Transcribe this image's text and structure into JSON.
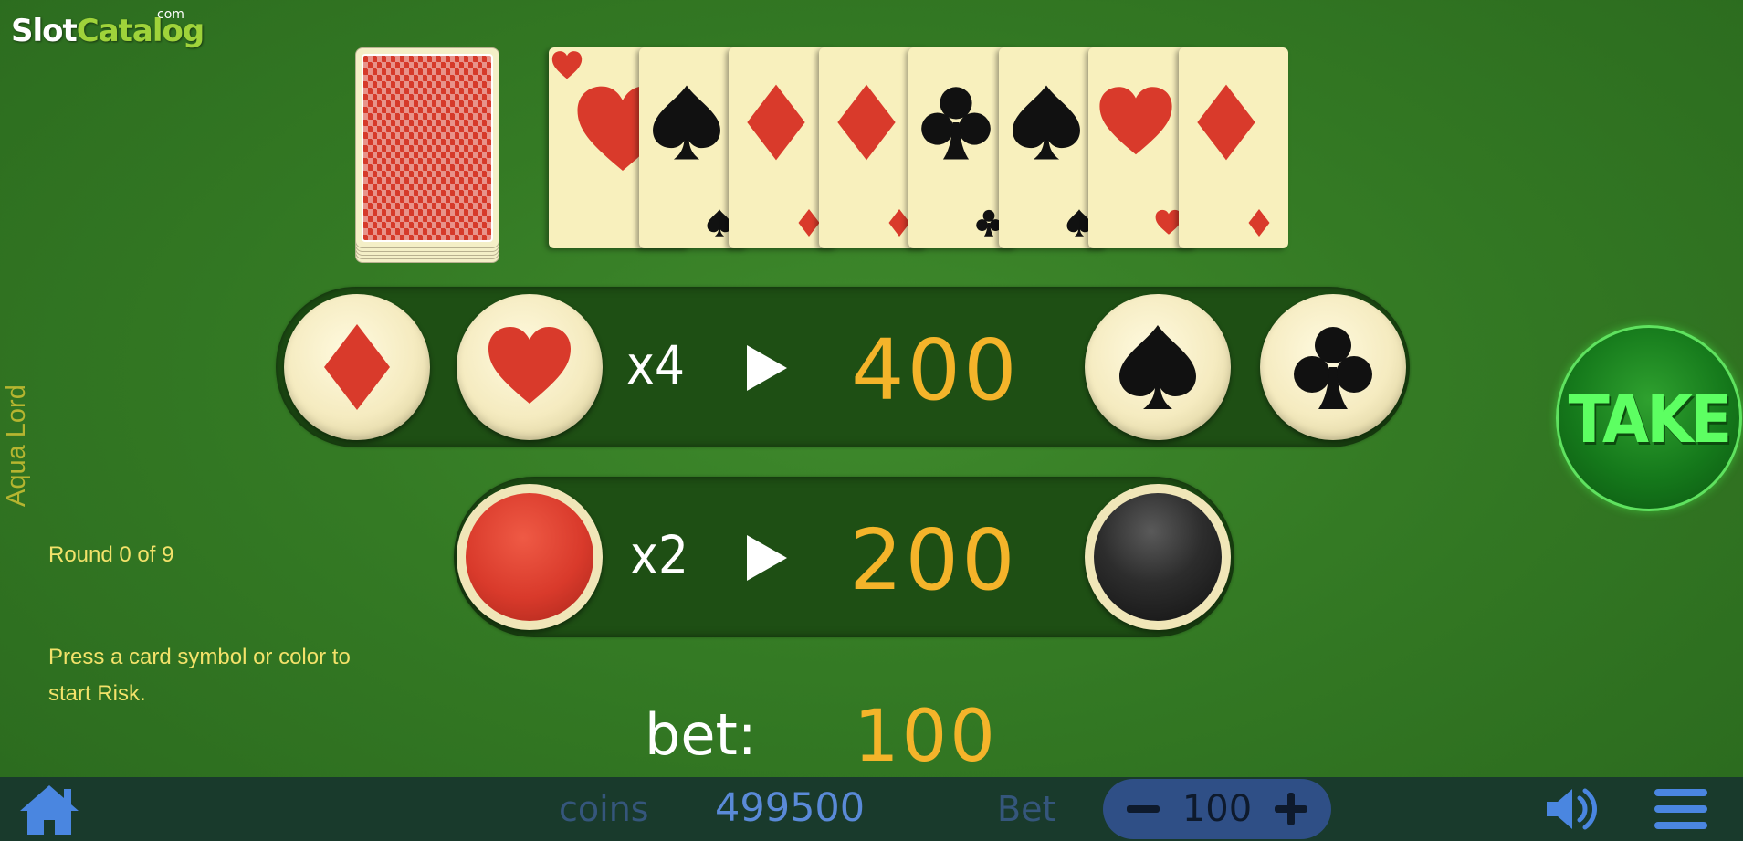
{
  "watermark": {
    "part1": "Slot",
    "part2": "Catalog",
    "suffix": "com"
  },
  "game_title": "Aqua Lord",
  "round_info": "Round 0  of 9",
  "hint": "Press a card symbol or color to start Risk.",
  "history_cards": [
    "hearts",
    "spades",
    "diamonds",
    "diamonds",
    "clubs",
    "spades",
    "hearts",
    "diamonds"
  ],
  "suit_bet": {
    "multiplier": "x4",
    "amount": "400",
    "options": [
      "diamonds",
      "hearts",
      "spades",
      "clubs"
    ]
  },
  "color_bet": {
    "multiplier": "x2",
    "amount": "200",
    "options": [
      "red",
      "black"
    ]
  },
  "take_button": "TAKE",
  "bet_display": {
    "label": "bet:",
    "value": "100"
  },
  "toolbar": {
    "coins_label": "coins",
    "coins_value": "499500",
    "bet_label": "Bet",
    "bet_value": "100",
    "minus": "−",
    "plus": "+"
  },
  "colors": {
    "red": "#d93a2b",
    "black": "#111111",
    "gold": "#f4b42a",
    "felt": "#347a24"
  }
}
